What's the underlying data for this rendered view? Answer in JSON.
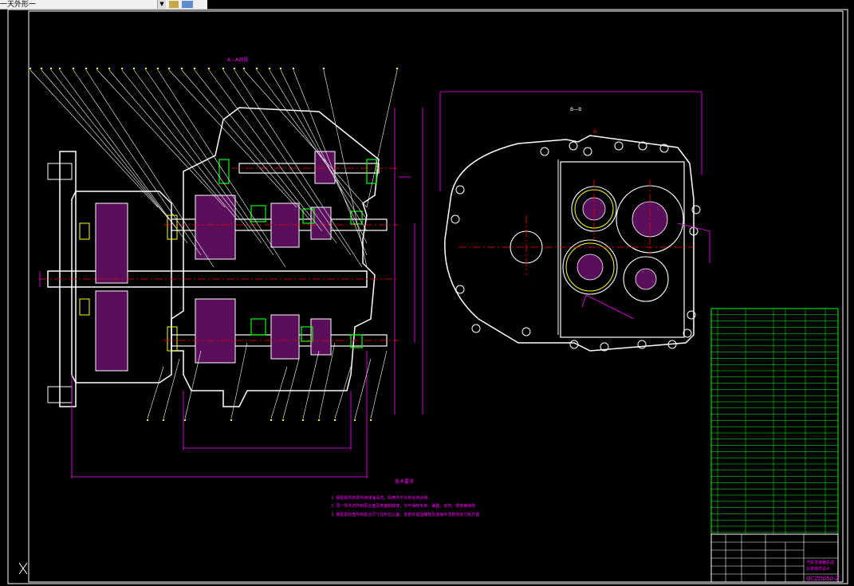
{
  "toolbar": {
    "command_text": "一天外形一",
    "dropdown_icon": "chevron-down-icon",
    "tool_icons": [
      "layer-icon",
      "match-properties-icon"
    ]
  },
  "drawing": {
    "section_label": "A—A剖视",
    "view_label": "B—B",
    "view_arrow_label": "A",
    "tech_req_title": "技术要求",
    "tech_req_lines": [
      "1. 装配前所有零件用煤油清洗，机壳内不许有任何杂物，",
      "2. 同一零件的所有配合面及表面粗糙度，均不得有毛刺、磕碰、划伤、锈蚀等缺陷",
      "3. 装配前检查所有配合尺寸及形位公差，各部件紧固螺栓及连接件须按规定力矩拧紧"
    ],
    "title_block": {
      "name_line1": "汽车变速器总成",
      "name_line2": "及零部件设计",
      "drawing_no": "QCZD050-Z"
    },
    "colors": {
      "outline": "#ffffff",
      "dimension": "#ff00ff",
      "hatch": "#ff00ff",
      "centerline": "#ff0000",
      "table": "#00ff00",
      "leader": "#ffffff",
      "callout_text": "#ffff00"
    }
  }
}
